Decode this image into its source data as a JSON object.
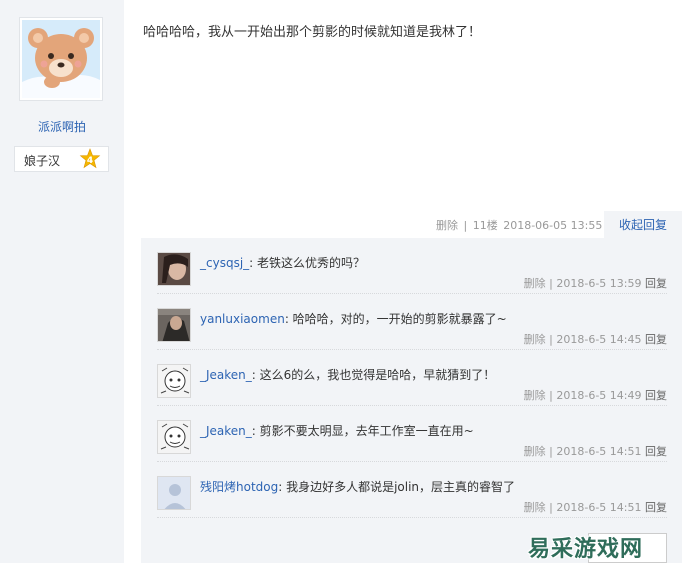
{
  "author": {
    "name": "派派啊拍",
    "level_name": "娘子汉",
    "level_number": "4"
  },
  "post": {
    "content": "哈哈哈哈，我从一开始出那个剪影的时候就知道是我林了！",
    "delete_label": "删除",
    "separator": "|",
    "floor": "11楼",
    "timestamp": "2018-06-05 13:55",
    "collapse_reply_label": "收起回复"
  },
  "replies": [
    {
      "user": "_cysqsj_",
      "text": ": 老铁这么优秀的吗？",
      "delete_label": "删除",
      "separator": "|",
      "time": "2018-6-5 13:59",
      "reply_label": "回复"
    },
    {
      "user": "yanluxiaomen",
      "text": ": 哈哈哈，对的，一开始的剪影就暴露了~",
      "delete_label": "删除",
      "separator": "|",
      "time": "2018-6-5 14:45",
      "reply_label": "回复"
    },
    {
      "user": "_Jeaken_",
      "text": ": 这么6的么，我也觉得是哈哈，早就猜到了！",
      "delete_label": "删除",
      "separator": "|",
      "time": "2018-6-5 14:49",
      "reply_label": "回复"
    },
    {
      "user": "_Jeaken_",
      "text": ": 剪影不要太明显，去年工作室一直在用~",
      "delete_label": "删除",
      "separator": "|",
      "time": "2018-6-5 14:51",
      "reply_label": "回复"
    },
    {
      "user": "残阳烤hotdog",
      "text": ": 我身边好多人都说是jolin，层主真的睿智了",
      "delete_label": "删除",
      "separator": "|",
      "time": "2018-6-5 14:51",
      "reply_label": "回复"
    }
  ],
  "watermark": "易采游戏网",
  "colors": {
    "link": "#2d64b3",
    "panel": "#f2f4f7",
    "meta": "#999999"
  }
}
